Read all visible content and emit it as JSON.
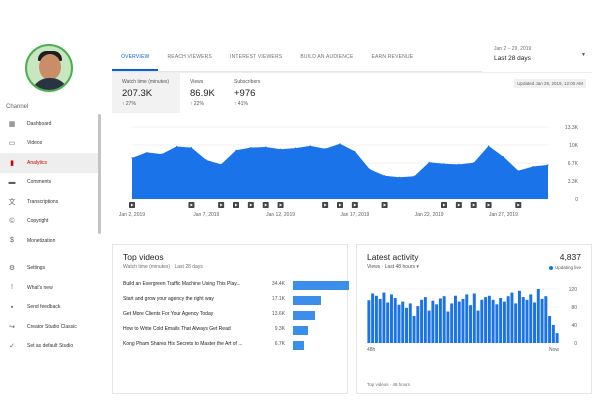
{
  "sidebar": {
    "channel_label": "Channel",
    "items": [
      {
        "label": "Dashboard",
        "icon": "dashboard-icon",
        "glyph": "▦"
      },
      {
        "label": "Videos",
        "icon": "videos-icon",
        "glyph": "▭"
      },
      {
        "label": "Analytics",
        "icon": "analytics-icon",
        "glyph": "▮",
        "active": true
      },
      {
        "label": "Comments",
        "icon": "comments-icon",
        "glyph": "▬"
      },
      {
        "label": "Transcriptions",
        "icon": "transcriptions-icon",
        "glyph": "文"
      },
      {
        "label": "Copyright",
        "icon": "copyright-icon",
        "glyph": "©"
      },
      {
        "label": "Monetization",
        "icon": "monetization-icon",
        "glyph": "$"
      }
    ],
    "footer_items": [
      {
        "label": "Settings",
        "icon": "settings-icon",
        "glyph": "⚙"
      },
      {
        "label": "What's new",
        "icon": "whats-new-icon",
        "glyph": "!"
      },
      {
        "label": "Send feedback",
        "icon": "feedback-icon",
        "glyph": "▪"
      },
      {
        "label": "Creator Studio Classic",
        "icon": "classic-studio-icon",
        "glyph": "↪"
      },
      {
        "label": "Set as default Studio",
        "icon": "default-studio-icon",
        "glyph": "✓"
      }
    ]
  },
  "tabs": [
    {
      "label": "OVERVIEW",
      "active": true
    },
    {
      "label": "REACH VIEWERS"
    },
    {
      "label": "INTEREST VIEWERS"
    },
    {
      "label": "BUILD AN AUDIENCE"
    },
    {
      "label": "EARN REVENUE"
    }
  ],
  "date_range": {
    "range": "Jan 2 – 29, 2019",
    "label": "Last 28 days"
  },
  "metrics": [
    {
      "label": "Watch time (minutes)",
      "value": "207.3K",
      "change": "27%"
    },
    {
      "label": "Views",
      "value": "86.9K",
      "change": "22%"
    },
    {
      "label": "Subscribers",
      "value": "+976",
      "change": "41%"
    }
  ],
  "updated": "Updated Jan 29, 2019, 12:00 AM",
  "chart_data": {
    "type": "area",
    "x_labels": [
      "Jan 2, 2019",
      "Jan 7, 2019",
      "Jan 12, 2019",
      "Jan 17, 2019",
      "Jan 22, 2019",
      "Jan 27, 2019"
    ],
    "y_ticks": [
      "13.3K",
      "10K",
      "6.7K",
      "3.3K",
      "0"
    ],
    "ylim": [
      0,
      13300
    ],
    "values": [
      7600,
      8600,
      8300,
      9700,
      9500,
      7200,
      6400,
      9000,
      9500,
      9600,
      9200,
      9400,
      9800,
      9300,
      10200,
      8800,
      5500,
      4300,
      4000,
      4200,
      6800,
      6500,
      6400,
      6700,
      9800,
      7800,
      5200,
      6000,
      6300
    ],
    "color": "#1a73e8"
  },
  "top_videos": {
    "title": "Top videos",
    "subtitle": "Watch time (minutes) · Last 28 days",
    "rows": [
      {
        "title": "Build an Evergreen Traffic Machine Using This Play...",
        "views": "34.4K",
        "value": 34.4
      },
      {
        "title": "Start and grow your agency the right way",
        "views": "17.1K",
        "value": 17.1
      },
      {
        "title": "Get More Clients For Your Agency Today",
        "views": "13.6K",
        "value": 13.6
      },
      {
        "title": "How to Write Cold Emails That Always Get Read",
        "views": "9.3K",
        "value": 9.3
      },
      {
        "title": "Kong Pham Shares His Secrets to Master the Art of ...",
        "views": "6.7K",
        "value": 6.7
      }
    ]
  },
  "latest_activity": {
    "title": "Latest activity",
    "count": "4,837",
    "updating": "Updating live",
    "selector": "Views · Last 48 hours",
    "y_ticks": [
      "120",
      "80",
      "40",
      "0"
    ],
    "x_start": "48h",
    "x_end": "Now",
    "footer": "Top videos · 48 hours",
    "values": [
      95,
      110,
      105,
      98,
      112,
      90,
      108,
      100,
      85,
      92,
      78,
      88,
      60,
      82,
      96,
      102,
      72,
      94,
      86,
      99,
      104,
      70,
      88,
      105,
      92,
      98,
      108,
      84,
      110,
      72,
      96,
      102,
      105,
      96,
      86,
      100,
      92,
      104,
      112,
      88,
      116,
      102,
      96,
      108,
      90,
      120,
      98,
      104,
      60,
      40,
      22
    ]
  }
}
